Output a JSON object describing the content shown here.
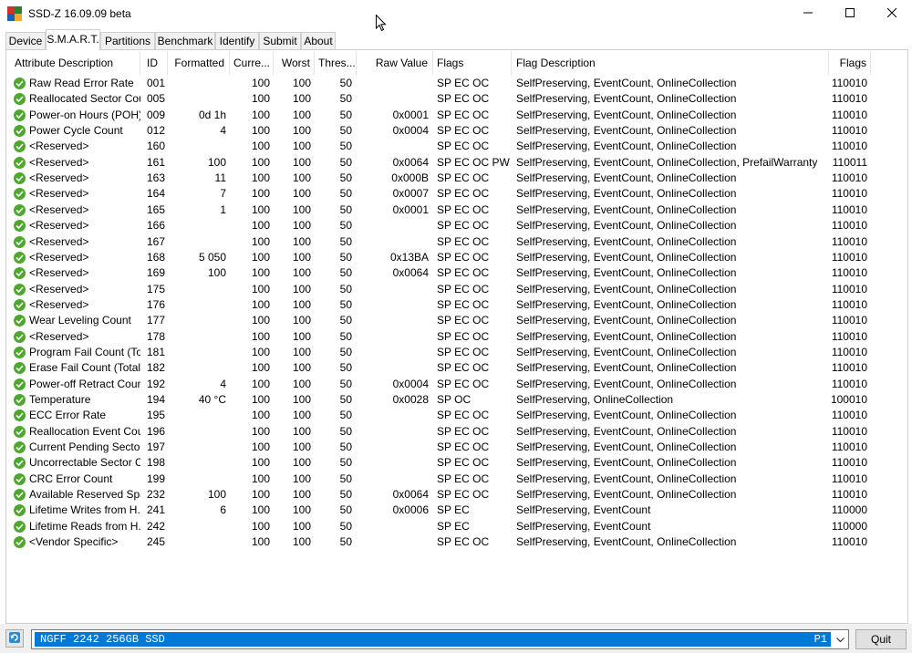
{
  "window": {
    "title": "SSD-Z 16.09.09 beta",
    "minimize_glyph": "—",
    "maximize_glyph": "☐",
    "close_glyph": "✕"
  },
  "tabs": [
    {
      "label": "Device"
    },
    {
      "label": "S.M.A.R.T."
    },
    {
      "label": "Partitions"
    },
    {
      "label": "Benchmark"
    },
    {
      "label": "Identify"
    },
    {
      "label": "Submit"
    },
    {
      "label": "About"
    }
  ],
  "active_tab": "S.M.A.R.T.",
  "columns": [
    "Attribute Description",
    "ID",
    "Formatted",
    "Curre...",
    "Worst",
    "Thres...",
    "Raw Value",
    "Flags",
    "Flag Description",
    "Flags"
  ],
  "rows": [
    {
      "attr": "Raw Read Error Rate",
      "id": "001",
      "fmt": "",
      "cur": "100",
      "worst": "100",
      "thr": "50",
      "raw": "",
      "flags": "SP EC OC",
      "desc": "SelfPreserving, EventCount, OnlineCollection",
      "bits": "110010"
    },
    {
      "attr": "Reallocated Sector Cou...",
      "id": "005",
      "fmt": "",
      "cur": "100",
      "worst": "100",
      "thr": "50",
      "raw": "",
      "flags": "SP EC OC",
      "desc": "SelfPreserving, EventCount, OnlineCollection",
      "bits": "110010"
    },
    {
      "attr": "Power-on Hours (POH)",
      "id": "009",
      "fmt": "0d 1h",
      "cur": "100",
      "worst": "100",
      "thr": "50",
      "raw": "0x0001",
      "flags": "SP EC OC",
      "desc": "SelfPreserving, EventCount, OnlineCollection",
      "bits": "110010"
    },
    {
      "attr": "Power Cycle Count",
      "id": "012",
      "fmt": "4",
      "cur": "100",
      "worst": "100",
      "thr": "50",
      "raw": "0x0004",
      "flags": "SP EC OC",
      "desc": "SelfPreserving, EventCount, OnlineCollection",
      "bits": "110010"
    },
    {
      "attr": "<Reserved>",
      "id": "160",
      "fmt": "",
      "cur": "100",
      "worst": "100",
      "thr": "50",
      "raw": "",
      "flags": "SP EC OC",
      "desc": "SelfPreserving, EventCount, OnlineCollection",
      "bits": "110010"
    },
    {
      "attr": "<Reserved>",
      "id": "161",
      "fmt": "100",
      "cur": "100",
      "worst": "100",
      "thr": "50",
      "raw": "0x0064",
      "flags": "SP EC OC PW",
      "desc": "SelfPreserving, EventCount, OnlineCollection, PrefailWarranty",
      "bits": "110011"
    },
    {
      "attr": "<Reserved>",
      "id": "163",
      "fmt": "11",
      "cur": "100",
      "worst": "100",
      "thr": "50",
      "raw": "0x000B",
      "flags": "SP EC OC",
      "desc": "SelfPreserving, EventCount, OnlineCollection",
      "bits": "110010"
    },
    {
      "attr": "<Reserved>",
      "id": "164",
      "fmt": "7",
      "cur": "100",
      "worst": "100",
      "thr": "50",
      "raw": "0x0007",
      "flags": "SP EC OC",
      "desc": "SelfPreserving, EventCount, OnlineCollection",
      "bits": "110010"
    },
    {
      "attr": "<Reserved>",
      "id": "165",
      "fmt": "1",
      "cur": "100",
      "worst": "100",
      "thr": "50",
      "raw": "0x0001",
      "flags": "SP EC OC",
      "desc": "SelfPreserving, EventCount, OnlineCollection",
      "bits": "110010"
    },
    {
      "attr": "<Reserved>",
      "id": "166",
      "fmt": "",
      "cur": "100",
      "worst": "100",
      "thr": "50",
      "raw": "",
      "flags": "SP EC OC",
      "desc": "SelfPreserving, EventCount, OnlineCollection",
      "bits": "110010"
    },
    {
      "attr": "<Reserved>",
      "id": "167",
      "fmt": "",
      "cur": "100",
      "worst": "100",
      "thr": "50",
      "raw": "",
      "flags": "SP EC OC",
      "desc": "SelfPreserving, EventCount, OnlineCollection",
      "bits": "110010"
    },
    {
      "attr": "<Reserved>",
      "id": "168",
      "fmt": "5 050",
      "cur": "100",
      "worst": "100",
      "thr": "50",
      "raw": "0x13BA",
      "flags": "SP EC OC",
      "desc": "SelfPreserving, EventCount, OnlineCollection",
      "bits": "110010"
    },
    {
      "attr": "<Reserved>",
      "id": "169",
      "fmt": "100",
      "cur": "100",
      "worst": "100",
      "thr": "50",
      "raw": "0x0064",
      "flags": "SP EC OC",
      "desc": "SelfPreserving, EventCount, OnlineCollection",
      "bits": "110010"
    },
    {
      "attr": "<Reserved>",
      "id": "175",
      "fmt": "",
      "cur": "100",
      "worst": "100",
      "thr": "50",
      "raw": "",
      "flags": "SP EC OC",
      "desc": "SelfPreserving, EventCount, OnlineCollection",
      "bits": "110010"
    },
    {
      "attr": "<Reserved>",
      "id": "176",
      "fmt": "",
      "cur": "100",
      "worst": "100",
      "thr": "50",
      "raw": "",
      "flags": "SP EC OC",
      "desc": "SelfPreserving, EventCount, OnlineCollection",
      "bits": "110010"
    },
    {
      "attr": "Wear Leveling Count",
      "id": "177",
      "fmt": "",
      "cur": "100",
      "worst": "100",
      "thr": "50",
      "raw": "",
      "flags": "SP EC OC",
      "desc": "SelfPreserving, EventCount, OnlineCollection",
      "bits": "110010"
    },
    {
      "attr": "<Reserved>",
      "id": "178",
      "fmt": "",
      "cur": "100",
      "worst": "100",
      "thr": "50",
      "raw": "",
      "flags": "SP EC OC",
      "desc": "SelfPreserving, EventCount, OnlineCollection",
      "bits": "110010"
    },
    {
      "attr": "Program Fail Count (To...",
      "id": "181",
      "fmt": "",
      "cur": "100",
      "worst": "100",
      "thr": "50",
      "raw": "",
      "flags": "SP EC OC",
      "desc": "SelfPreserving, EventCount, OnlineCollection",
      "bits": "110010"
    },
    {
      "attr": "Erase Fail Count (Total)",
      "id": "182",
      "fmt": "",
      "cur": "100",
      "worst": "100",
      "thr": "50",
      "raw": "",
      "flags": "SP EC OC",
      "desc": "SelfPreserving, EventCount, OnlineCollection",
      "bits": "110010"
    },
    {
      "attr": "Power-off Retract Count",
      "id": "192",
      "fmt": "4",
      "cur": "100",
      "worst": "100",
      "thr": "50",
      "raw": "0x0004",
      "flags": "SP EC OC",
      "desc": "SelfPreserving, EventCount, OnlineCollection",
      "bits": "110010"
    },
    {
      "attr": "Temperature",
      "id": "194",
      "fmt": "40 °C",
      "cur": "100",
      "worst": "100",
      "thr": "50",
      "raw": "0x0028",
      "flags": "SP OC",
      "desc": "SelfPreserving, OnlineCollection",
      "bits": "100010"
    },
    {
      "attr": "ECC Error Rate",
      "id": "195",
      "fmt": "",
      "cur": "100",
      "worst": "100",
      "thr": "50",
      "raw": "",
      "flags": "SP EC OC",
      "desc": "SelfPreserving, EventCount, OnlineCollection",
      "bits": "110010"
    },
    {
      "attr": "Reallocation Event Cou...",
      "id": "196",
      "fmt": "",
      "cur": "100",
      "worst": "100",
      "thr": "50",
      "raw": "",
      "flags": "SP EC OC",
      "desc": "SelfPreserving, EventCount, OnlineCollection",
      "bits": "110010"
    },
    {
      "attr": "Current Pending Secto...",
      "id": "197",
      "fmt": "",
      "cur": "100",
      "worst": "100",
      "thr": "50",
      "raw": "",
      "flags": "SP EC OC",
      "desc": "SelfPreserving, EventCount, OnlineCollection",
      "bits": "110010"
    },
    {
      "attr": "Uncorrectable Sector C...",
      "id": "198",
      "fmt": "",
      "cur": "100",
      "worst": "100",
      "thr": "50",
      "raw": "",
      "flags": "SP EC OC",
      "desc": "SelfPreserving, EventCount, OnlineCollection",
      "bits": "110010"
    },
    {
      "attr": "CRC Error Count",
      "id": "199",
      "fmt": "",
      "cur": "100",
      "worst": "100",
      "thr": "50",
      "raw": "",
      "flags": "SP EC OC",
      "desc": "SelfPreserving, EventCount, OnlineCollection",
      "bits": "110010"
    },
    {
      "attr": "Available Reserved Spa...",
      "id": "232",
      "fmt": "100",
      "cur": "100",
      "worst": "100",
      "thr": "50",
      "raw": "0x0064",
      "flags": "SP EC OC",
      "desc": "SelfPreserving, EventCount, OnlineCollection",
      "bits": "110010"
    },
    {
      "attr": "Lifetime Writes from H...",
      "id": "241",
      "fmt": "6",
      "cur": "100",
      "worst": "100",
      "thr": "50",
      "raw": "0x0006",
      "flags": "SP EC",
      "desc": "SelfPreserving, EventCount",
      "bits": "110000"
    },
    {
      "attr": "Lifetime Reads from H...",
      "id": "242",
      "fmt": "",
      "cur": "100",
      "worst": "100",
      "thr": "50",
      "raw": "",
      "flags": "SP EC",
      "desc": "SelfPreserving, EventCount",
      "bits": "110000"
    },
    {
      "attr": "<Vendor Specific>",
      "id": "245",
      "fmt": "",
      "cur": "100",
      "worst": "100",
      "thr": "50",
      "raw": "",
      "flags": "SP EC OC",
      "desc": "SelfPreserving, EventCount, OnlineCollection",
      "bits": "110010"
    }
  ],
  "drive": {
    "name": "NGFF 2242 256GB SSD",
    "port": "P1"
  },
  "quit_label": "Quit",
  "colors": {
    "ok_status": "#4ea72e",
    "selection": "#0078d7"
  }
}
